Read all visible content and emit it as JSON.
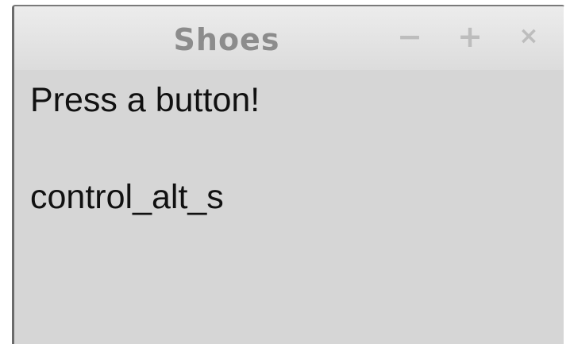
{
  "window": {
    "title": "Shoes",
    "controls": {
      "minimize": "−",
      "maximize": "+",
      "close": "×"
    }
  },
  "content": {
    "prompt": "Press a button!",
    "last_key": "control_alt_s"
  },
  "colors": {
    "background": "#d6d6d6",
    "title_text": "#8c8c8c",
    "text": "#111111"
  }
}
